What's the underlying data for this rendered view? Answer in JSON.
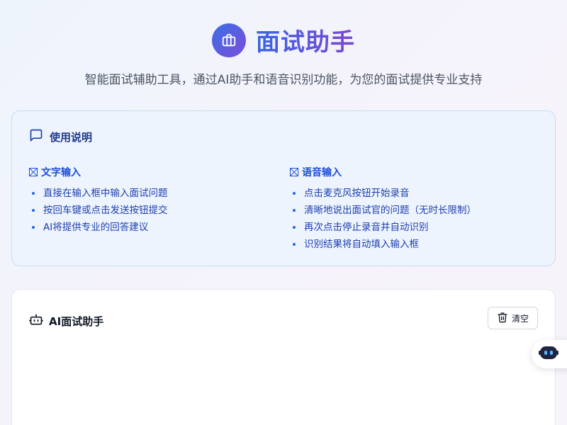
{
  "header": {
    "title": "面试助手",
    "subtitle": "智能面试辅助工具，通过AI助手和语音识别功能，为您的面试提供专业支持",
    "logo_icon": "briefcase-icon"
  },
  "instructions": {
    "title": "使用说明",
    "icon": "message-square-icon",
    "text_input": {
      "heading": "文字输入",
      "items": [
        "直接在输入框中输入面试问题",
        "按回车键或点击发送按钮提交",
        "AI将提供专业的回答建议"
      ]
    },
    "voice_input": {
      "heading": "语音输入",
      "items": [
        "点击麦克风按钮开始录音",
        "清晰地说出面试官的问题（无时长限制）",
        "再次点击停止录音并自动识别",
        "识别结果将自动填入输入框"
      ]
    }
  },
  "chat": {
    "title": "AI面试助手",
    "icon": "bot-icon",
    "clear_label": "清空",
    "clear_icon": "trash-icon"
  },
  "floating": {
    "icon": "robot-face-icon"
  },
  "colors": {
    "accent_start": "#3b6fe6",
    "accent_end": "#7c4ddb",
    "instructions_bg": "#eef4fd"
  }
}
